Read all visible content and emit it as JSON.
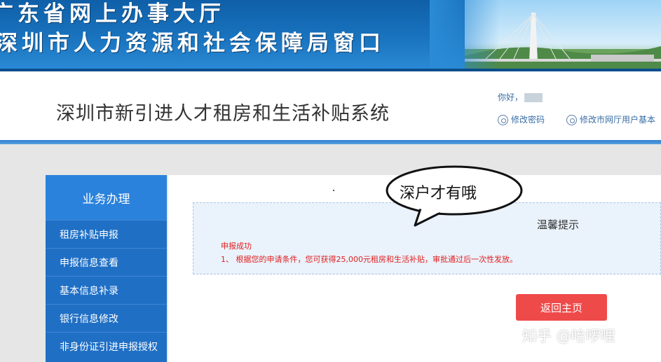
{
  "banner": {
    "line1": "广东省网上办事大厅",
    "line2": "深圳市人力资源和社会保障局窗口"
  },
  "header": {
    "system_title": "深圳市新引进人才租房和生活补贴系统",
    "greeting": "你好，",
    "links": [
      "修改密码",
      "修改市网厅用户基本"
    ]
  },
  "sidebar": {
    "title": "业务办理",
    "items": [
      {
        "label": "租房补贴申报"
      },
      {
        "label": "申报信息查看"
      },
      {
        "label": "基本信息补录"
      },
      {
        "label": "银行信息修改"
      },
      {
        "label": "非身份证引进申报授权"
      }
    ]
  },
  "notice": {
    "title": "温馨提示",
    "status": "申报成功",
    "message": "1、 根据您的申请条件，您可获得25,000元租房和生活补贴，审批通过后一次性发放。"
  },
  "actions": {
    "back_label": "返回主页"
  },
  "bubble": {
    "text": "深户才有哦"
  },
  "watermark": {
    "text": "知乎 @哈啰哩"
  },
  "colors": {
    "banner_blue": "#1a74bf",
    "sidebar_blue": "#1f6fc5",
    "accent_red": "#ef4a4a",
    "notice_red": "#e02020"
  }
}
